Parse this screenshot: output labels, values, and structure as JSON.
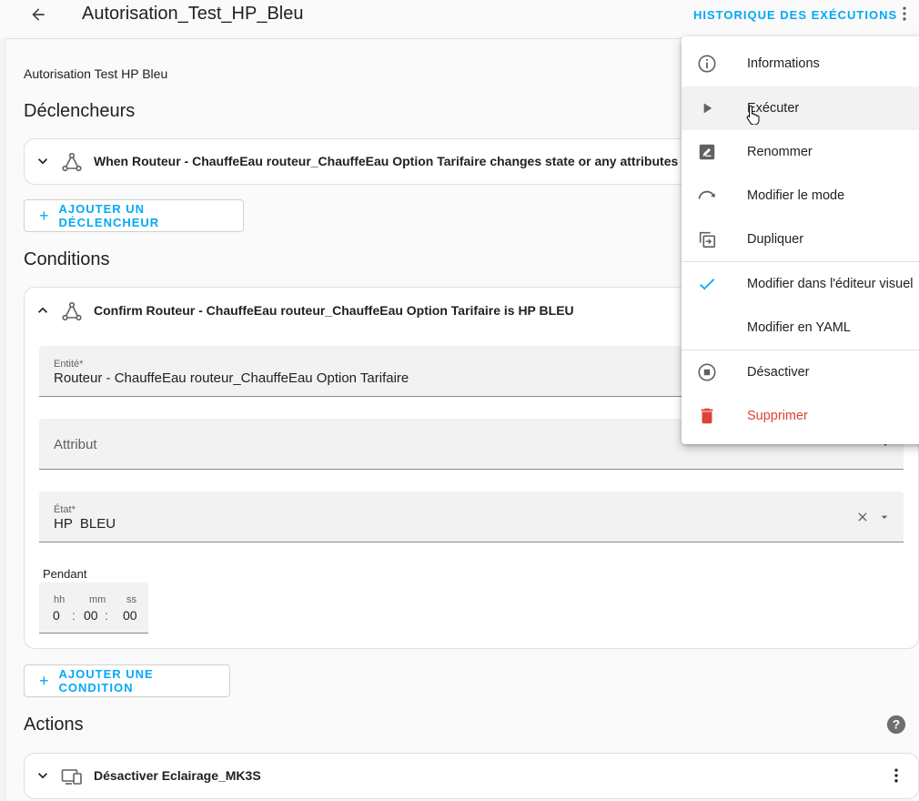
{
  "header": {
    "title": "Autorisation_Test_HP_Bleu",
    "history_label": "HISTORIQUE DES EXÉCUTIONS"
  },
  "description": "Autorisation Test HP Bleu",
  "triggers": {
    "title": "Déclencheurs",
    "items": [
      {
        "label": "When Routeur - ChauffeEau routeur_ChauffeEau Option Tarifaire changes state or any attributes"
      }
    ],
    "add_label": "AJOUTER UN DÉCLENCHEUR"
  },
  "conditions": {
    "title": "Conditions",
    "items": [
      {
        "label": "Confirm Routeur - ChauffeEau routeur_ChauffeEau Option Tarifaire is HP BLEU",
        "entity_label": "Entité*",
        "entity_value": "Routeur - ChauffeEau routeur_ChauffeEau Option Tarifaire",
        "attribute_placeholder": "Attribut",
        "state_label": "État*",
        "state_value": "HP  BLEU",
        "duration_label": "Pendant",
        "duration": {
          "hh_label": "hh",
          "mm_label": "mm",
          "ss_label": "ss",
          "hh": "0",
          "mm": "00",
          "ss": "00",
          "sep": ":"
        }
      }
    ],
    "add_label": "AJOUTER UNE CONDITION"
  },
  "actions": {
    "title": "Actions",
    "items": [
      {
        "label": "Désactiver Eclairage_MK3S"
      }
    ]
  },
  "menu": {
    "items": [
      {
        "label": "Informations",
        "icon": "info-icon"
      },
      {
        "label": "Exécuter",
        "icon": "play-icon"
      },
      {
        "label": "Renommer",
        "icon": "rename-icon"
      },
      {
        "label": "Modifier le mode",
        "icon": "mode-icon"
      },
      {
        "label": "Dupliquer",
        "icon": "duplicate-icon"
      },
      {
        "label": "Modifier dans l'éditeur visuel",
        "icon": "check-icon"
      },
      {
        "label": "Modifier en YAML",
        "icon": ""
      },
      {
        "label": "Désactiver",
        "icon": "stop-circle-icon"
      },
      {
        "label": "Supprimer",
        "icon": "delete-icon"
      }
    ]
  },
  "colors": {
    "accent": "#03a9f4",
    "danger": "#db4437",
    "icon": "#616161"
  }
}
